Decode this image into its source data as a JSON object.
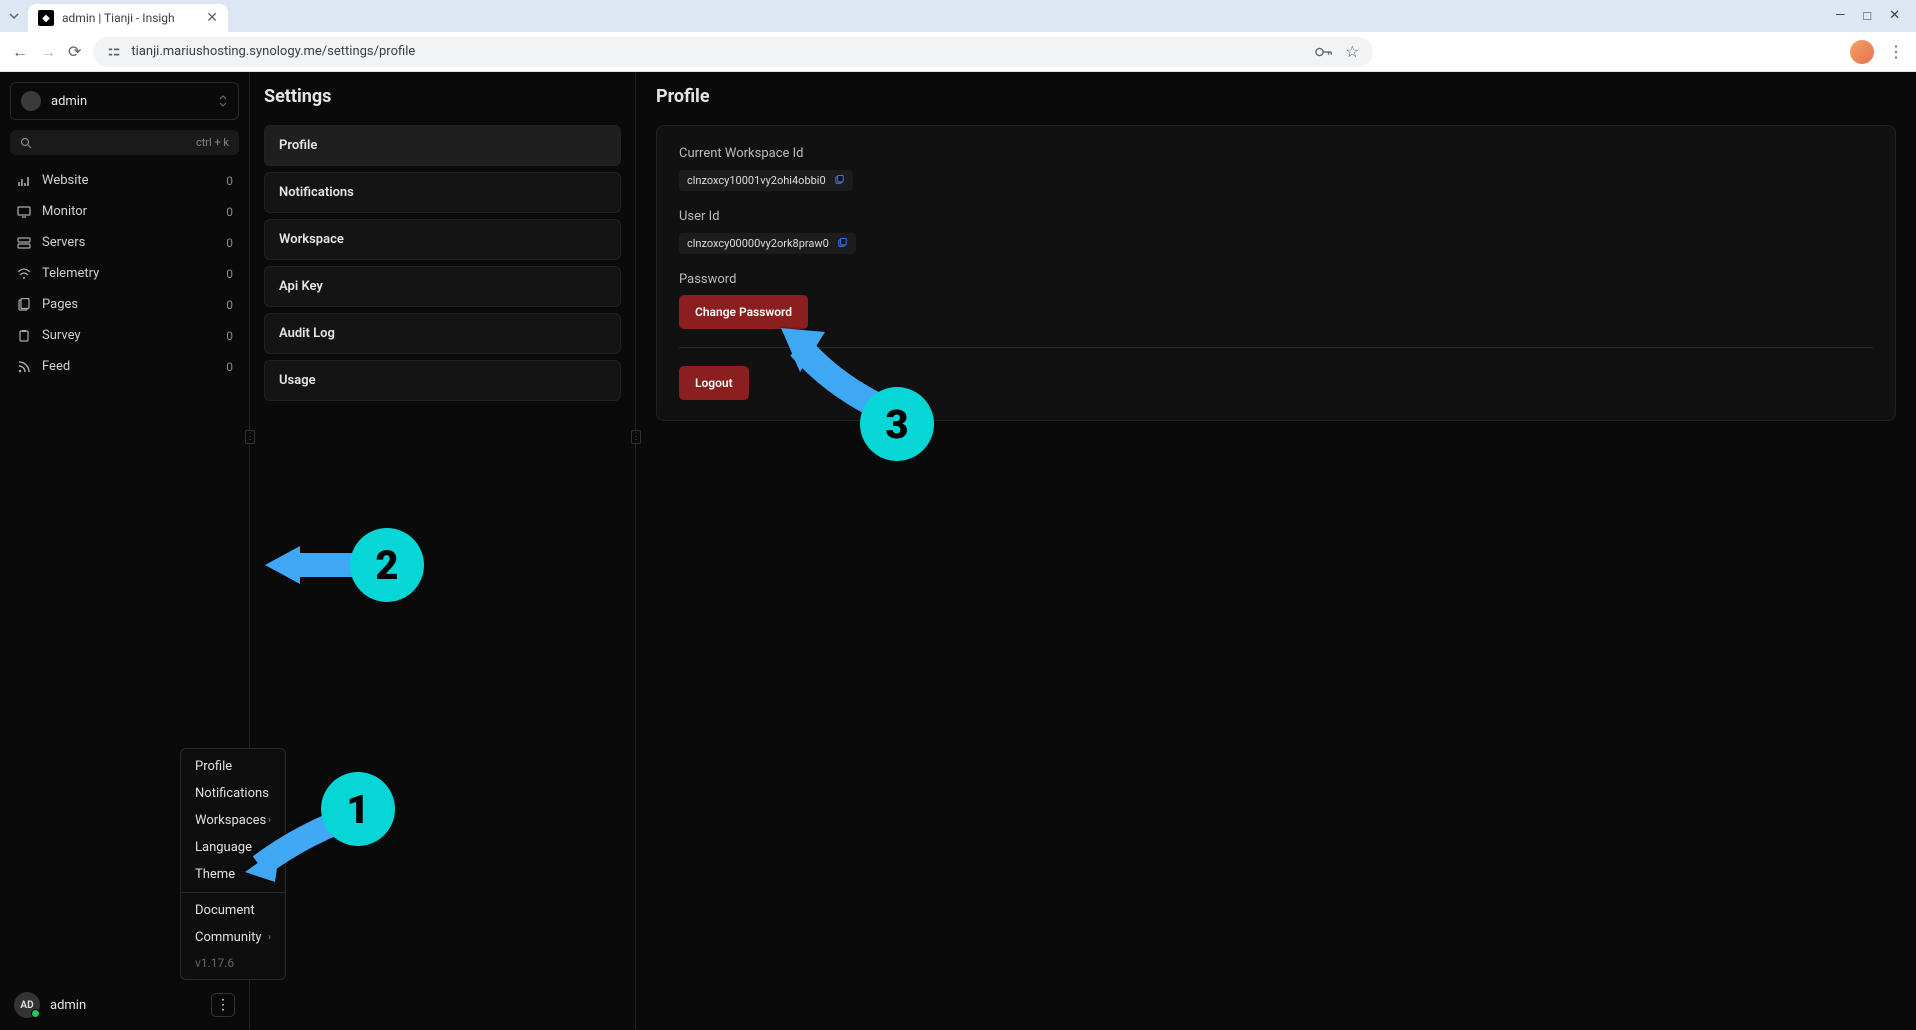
{
  "browser": {
    "tab_title": "admin | Tianji - Insigh",
    "url": "tianji.mariushosting.synology.me/settings/profile",
    "controls": {
      "minimize": "—",
      "maximize": "□",
      "close": "✕"
    }
  },
  "sidebar": {
    "workspace": {
      "name": "admin"
    },
    "search": {
      "placeholder": "",
      "shortcut": "ctrl + k"
    },
    "nav": [
      {
        "icon": "chart",
        "label": "Website",
        "count": "0"
      },
      {
        "icon": "monitor",
        "label": "Monitor",
        "count": "0"
      },
      {
        "icon": "server",
        "label": "Servers",
        "count": "0"
      },
      {
        "icon": "wifi",
        "label": "Telemetry",
        "count": "0"
      },
      {
        "icon": "pages",
        "label": "Pages",
        "count": "0"
      },
      {
        "icon": "survey",
        "label": "Survey",
        "count": "0"
      },
      {
        "icon": "feed",
        "label": "Feed",
        "count": "0"
      }
    ],
    "footer": {
      "initials": "AD",
      "name": "admin"
    }
  },
  "popup": {
    "items_top": [
      {
        "label": "Profile",
        "chevron": false
      },
      {
        "label": "Notifications",
        "chevron": false
      },
      {
        "label": "Workspaces",
        "chevron": true
      },
      {
        "label": "Language",
        "chevron": true
      },
      {
        "label": "Theme",
        "chevron": true
      }
    ],
    "items_bottom": [
      {
        "label": "Document",
        "chevron": false
      },
      {
        "label": "Community",
        "chevron": true
      }
    ],
    "version": "v1.17.6"
  },
  "settings": {
    "title": "Settings",
    "items": [
      "Profile",
      "Notifications",
      "Workspace",
      "Api Key",
      "Audit Log",
      "Usage"
    ]
  },
  "profile": {
    "title": "Profile",
    "workspace_id_label": "Current Workspace Id",
    "workspace_id": "clnzoxcy10001vy2ohi4obbi0",
    "user_id_label": "User Id",
    "user_id": "clnzoxcy00000vy2ork8praw0",
    "password_label": "Password",
    "change_password": "Change Password",
    "logout": "Logout"
  },
  "annotations": {
    "n1": "1",
    "n2": "2",
    "n3": "3"
  }
}
